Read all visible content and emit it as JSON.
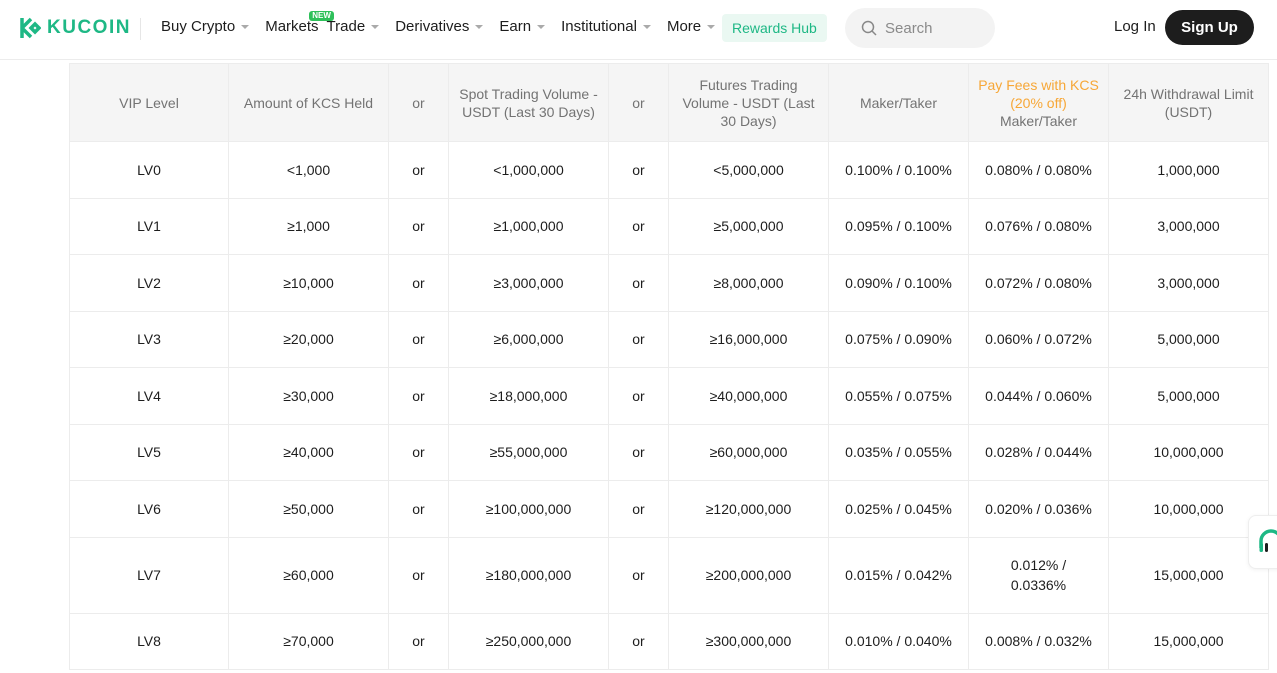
{
  "nav": {
    "logo": "KUCOIN",
    "items": [
      {
        "label": "Buy Crypto",
        "caret": true
      },
      {
        "label": "Markets",
        "badge": "NEW",
        "caret": false
      },
      {
        "label": "Trade",
        "caret": true
      },
      {
        "label": "Derivatives",
        "caret": true
      },
      {
        "label": "Earn",
        "caret": true
      },
      {
        "label": "Institutional",
        "caret": true
      },
      {
        "label": "More",
        "caret": true
      }
    ],
    "rewards": "Rewards Hub",
    "search_placeholder": "Search",
    "login": "Log In",
    "signup": "Sign Up"
  },
  "colors": {
    "brand": "#1eb885",
    "highlight": "#f7a737"
  },
  "table": {
    "headers": [
      "VIP Level",
      "Amount of KCS Held",
      "or",
      "Spot Trading Volume - USDT (Last 30 Days)",
      "or",
      "Futures Trading Volume - USDT (Last 30 Days)",
      "Maker/Taker",
      "Pay Fees with KCS (20% off)",
      "Maker/Taker",
      "24h Withdrawal Limit (USDT)"
    ],
    "rows": [
      [
        "LV0",
        "<1,000",
        "or",
        "<1,000,000",
        "or",
        "<5,000,000",
        "0.100% / 0.100%",
        "0.080% / 0.080%",
        "1,000,000"
      ],
      [
        "LV1",
        "≥1,000",
        "or",
        "≥1,000,000",
        "or",
        "≥5,000,000",
        "0.095% / 0.100%",
        "0.076% / 0.080%",
        "3,000,000"
      ],
      [
        "LV2",
        "≥10,000",
        "or",
        "≥3,000,000",
        "or",
        "≥8,000,000",
        "0.090% / 0.100%",
        "0.072% / 0.080%",
        "3,000,000"
      ],
      [
        "LV3",
        "≥20,000",
        "or",
        "≥6,000,000",
        "or",
        "≥16,000,000",
        "0.075% / 0.090%",
        "0.060% / 0.072%",
        "5,000,000"
      ],
      [
        "LV4",
        "≥30,000",
        "or",
        "≥18,000,000",
        "or",
        "≥40,000,000",
        "0.055% / 0.075%",
        "0.044% / 0.060%",
        "5,000,000"
      ],
      [
        "LV5",
        "≥40,000",
        "or",
        "≥55,000,000",
        "or",
        "≥60,000,000",
        "0.035% / 0.055%",
        "0.028% / 0.044%",
        "10,000,000"
      ],
      [
        "LV6",
        "≥50,000",
        "or",
        "≥100,000,000",
        "or",
        "≥120,000,000",
        "0.025% / 0.045%",
        "0.020% / 0.036%",
        "10,000,000"
      ],
      [
        "LV7",
        "≥60,000",
        "or",
        "≥180,000,000",
        "or",
        "≥200,000,000",
        "0.015% / 0.042%",
        "0.012% / 0.0336%",
        "15,000,000"
      ],
      [
        "LV8",
        "≥70,000",
        "or",
        "≥250,000,000",
        "or",
        "≥300,000,000",
        "0.010% / 0.040%",
        "0.008% / 0.032%",
        "15,000,000"
      ]
    ]
  }
}
